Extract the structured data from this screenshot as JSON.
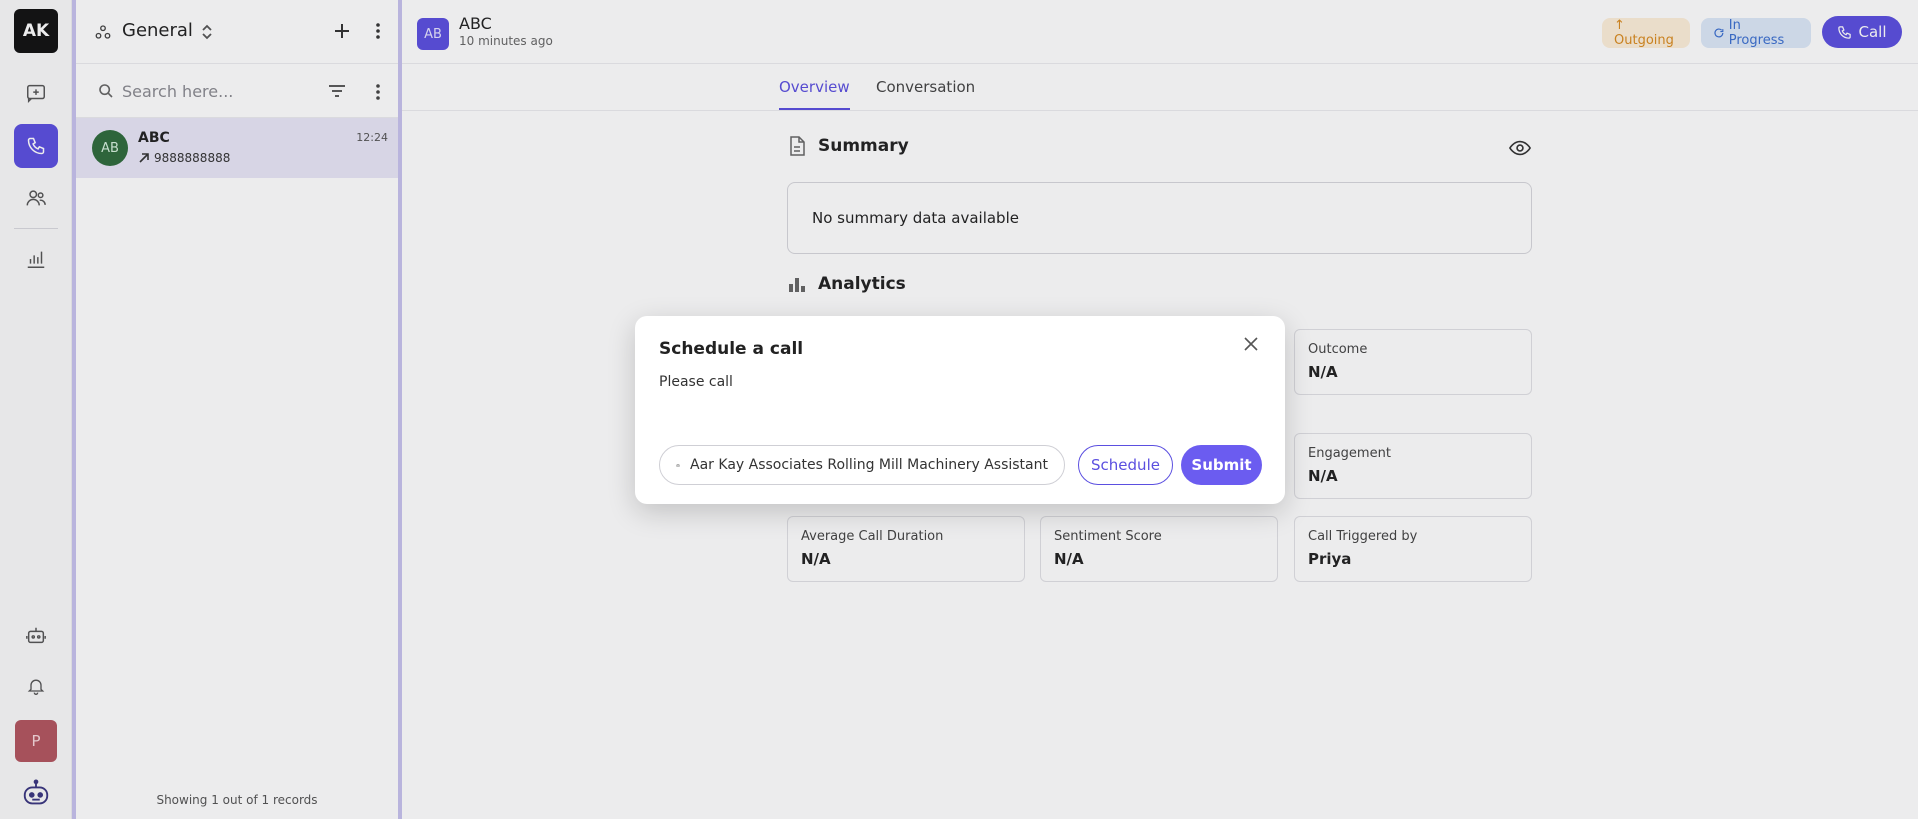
{
  "rail": {
    "logo_text": "AK",
    "items": [
      {
        "icon": "chat-icon"
      },
      {
        "icon": "phone-icon",
        "active": true
      },
      {
        "icon": "contacts-icon"
      },
      {
        "icon": "analytics-icon"
      }
    ],
    "bottom": [
      {
        "icon": "robot-icon"
      },
      {
        "icon": "bell-icon"
      }
    ],
    "avatar_text": "P",
    "brand_icon": "bot-logo-icon"
  },
  "panel": {
    "title": "General",
    "search_placeholder": "Search here...",
    "items": [
      {
        "initials": "AB",
        "name": "ABC",
        "phone": "9888888888",
        "time": "12:24"
      }
    ],
    "footer": "Showing 1 out of 1 records"
  },
  "header": {
    "avatar_initials": "AB",
    "name": "ABC",
    "time_ago": "10 minutes ago",
    "badge_outgoing": "↑ Outgoing",
    "badge_status": "In Progress",
    "call_label": "Call"
  },
  "tabs": [
    {
      "label": "Overview",
      "active": true
    },
    {
      "label": "Conversation",
      "active": false
    }
  ],
  "summary": {
    "title": "Summary",
    "text": "No summary data available"
  },
  "analytics": {
    "title": "Analytics",
    "cards": [
      {
        "label": "Outcome",
        "value": "N/A"
      },
      {
        "label": "Engagement",
        "value": "N/A"
      },
      {
        "label": "Average Call Duration",
        "value": "N/A"
      },
      {
        "label": "Sentiment Score",
        "value": "N/A"
      },
      {
        "label": "Call Triggered by",
        "value": "Priya"
      }
    ]
  },
  "modal": {
    "title": "Schedule a call",
    "text": "Please call",
    "agent_name": "Aar Kay Associates Rolling Mill Machinery Assistant",
    "schedule_label": "Schedule",
    "submit_label": "Submit"
  },
  "colors": {
    "accent": "#5b4fe0",
    "outgoing": "#d98a1e",
    "in_progress": "#3b6fd0"
  }
}
